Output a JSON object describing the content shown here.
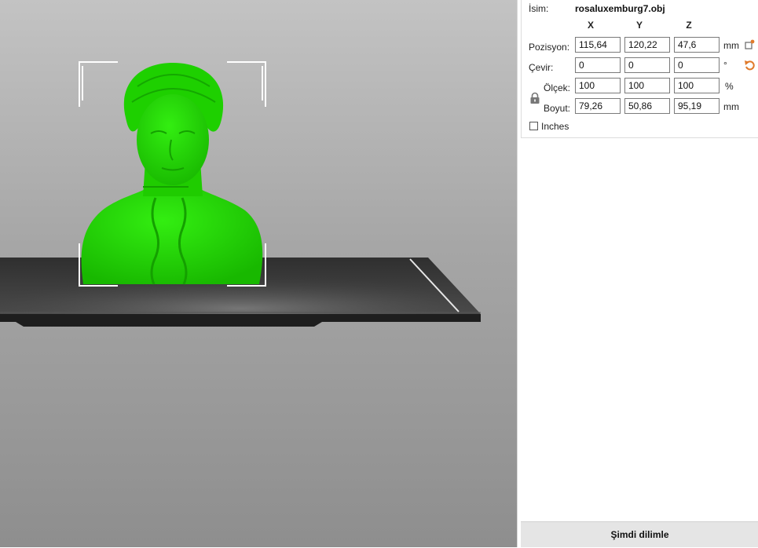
{
  "object": {
    "name_label": "İsim:",
    "name_value": "rosaluxemburg7.obj"
  },
  "axes": {
    "x": "X",
    "y": "Y",
    "z": "Z"
  },
  "position": {
    "label": "Pozisyon:",
    "x": "115,64",
    "y": "120,22",
    "z": "47,6",
    "unit": "mm"
  },
  "rotation": {
    "label": "Çevir:",
    "x": "0",
    "y": "0",
    "z": "0",
    "unit": "°"
  },
  "scale": {
    "label": "Ölçek:",
    "x": "100",
    "y": "100",
    "z": "100",
    "unit": "%"
  },
  "size": {
    "label": "Boyut:",
    "x": "79,26",
    "y": "50,86",
    "z": "95,19",
    "unit": "mm"
  },
  "inches": {
    "label": "Inches",
    "checked": false
  },
  "actions": {
    "slice_now": "Şimdi dilimle"
  },
  "colors": {
    "model": "#22dd00",
    "plate": "#3a3a3a",
    "reset_icon": "#e07a2a"
  }
}
